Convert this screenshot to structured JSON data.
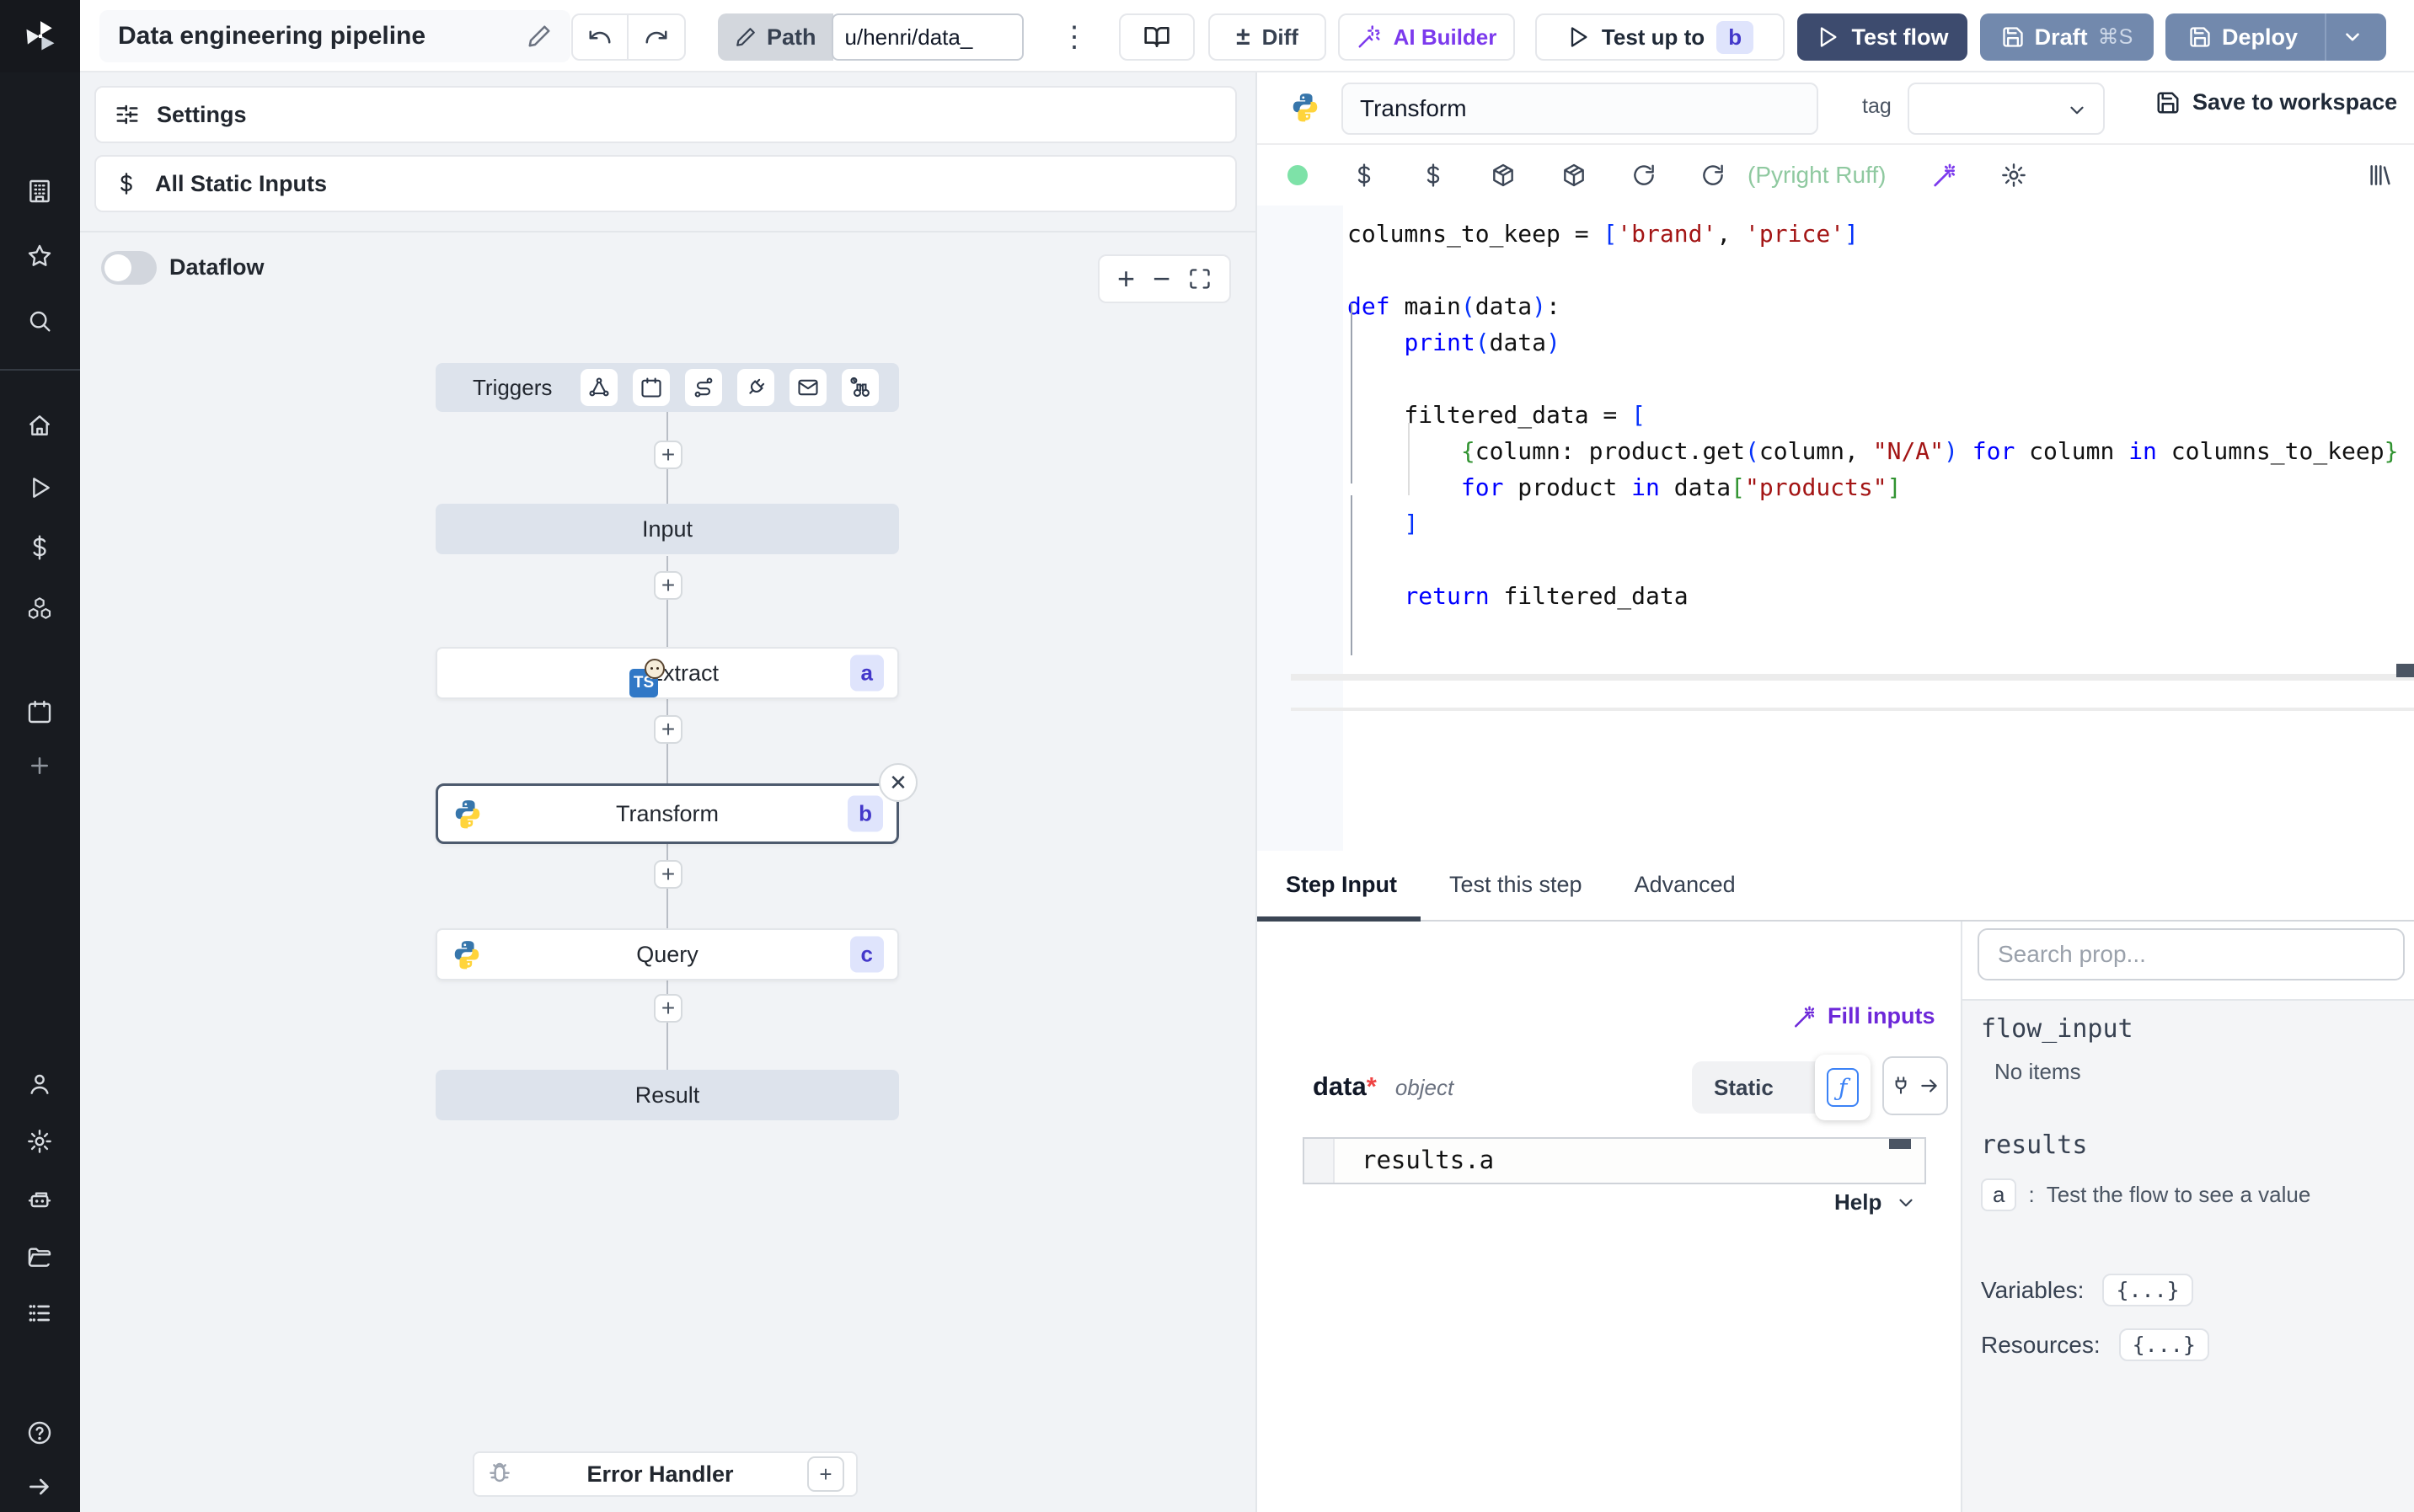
{
  "topbar": {
    "title": "Data engineering pipeline",
    "path_label": "Path",
    "path_value": "u/henri/data_",
    "kebab": "⋮",
    "diff_symbol": "±",
    "diff_label": "Diff",
    "ai_builder_label": "AI Builder",
    "test_up_to_label": "Test up to",
    "test_up_to_badge": "b",
    "test_flow_label": "Test flow",
    "draft_label": "Draft",
    "draft_shortcut": "⌘S",
    "deploy_label": "Deploy"
  },
  "left_panel": {
    "settings_label": "Settings",
    "all_static_inputs_label": "All Static Inputs",
    "dataflow_label": "Dataflow",
    "zoom_in": "+",
    "zoom_out": "−"
  },
  "flow": {
    "triggers_label": "Triggers",
    "input_label": "Input",
    "extract_label": "Extract",
    "extract_badge": "a",
    "extract_icon_text": "TS",
    "transform_label": "Transform",
    "transform_badge": "b",
    "close_symbol": "✕",
    "plus_symbol": "+",
    "query_label": "Query",
    "query_badge": "c",
    "result_label": "Result",
    "error_handler_label": "Error Handler"
  },
  "editor": {
    "step_name": "Transform",
    "tag_label": "tag",
    "save_label": "Save to workspace",
    "lint_status": "(Pyright Ruff)",
    "code_lines": [
      [
        [
          "t",
          "columns_to_keep = "
        ],
        [
          "b1",
          "["
        ],
        [
          "s",
          "'brand'"
        ],
        [
          "t",
          ", "
        ],
        [
          "s",
          "'price'"
        ],
        [
          "b1",
          "]"
        ]
      ],
      [],
      [
        [
          "k",
          "def "
        ],
        [
          "t",
          "main"
        ],
        [
          "b1",
          "("
        ],
        [
          "t",
          "data"
        ],
        [
          "b1",
          ")"
        ],
        [
          "t",
          ":"
        ]
      ],
      [
        [
          "t",
          "    "
        ],
        [
          "k",
          "print"
        ],
        [
          "b1",
          "("
        ],
        [
          "t",
          "data"
        ],
        [
          "b1",
          ")"
        ]
      ],
      [],
      [
        [
          "t",
          "    filtered_data = "
        ],
        [
          "b1",
          "["
        ]
      ],
      [
        [
          "t",
          "        "
        ],
        [
          "b2",
          "{"
        ],
        [
          "t",
          "column: product.get"
        ],
        [
          "b1",
          "("
        ],
        [
          "t",
          "column, "
        ],
        [
          "s",
          "\"N/A\""
        ],
        [
          "b1",
          ")"
        ],
        [
          "t",
          " "
        ],
        [
          "k",
          "for"
        ],
        [
          "t",
          " column "
        ],
        [
          "k",
          "in"
        ],
        [
          "t",
          " columns_to_keep"
        ],
        [
          "b2",
          "}"
        ]
      ],
      [
        [
          "t",
          "        "
        ],
        [
          "k",
          "for"
        ],
        [
          "t",
          " product "
        ],
        [
          "k",
          "in"
        ],
        [
          "t",
          " data"
        ],
        [
          "b2",
          "["
        ],
        [
          "s",
          "\"products\""
        ],
        [
          "b2",
          "]"
        ]
      ],
      [
        [
          "t",
          "    "
        ],
        [
          "b1",
          "]"
        ]
      ],
      [],
      [
        [
          "t",
          "    "
        ],
        [
          "k",
          "return"
        ],
        [
          "t",
          " filtered_data"
        ]
      ]
    ]
  },
  "tabs": {
    "step_input": "Step Input",
    "test_this_step": "Test this step",
    "advanced": "Advanced"
  },
  "step_input": {
    "fill_inputs_label": "Fill inputs",
    "field_name": "data",
    "field_required": "*",
    "field_type": "object",
    "static_label": "Static",
    "fn_symbol": "ƒ",
    "expr_value": "results.a",
    "help_label": "Help"
  },
  "props": {
    "search_placeholder": "Search prop...",
    "flow_input_label": "flow_input",
    "no_items": "No items",
    "results_label": "results",
    "result_key": "a",
    "result_separator": ":",
    "result_hint": "Test the flow to see a value",
    "variables_label": "Variables:",
    "resources_label": "Resources:",
    "object_preview": "{...}"
  },
  "colors": {
    "accent_purple": "#7c3aed",
    "dark_button": "#3d4b6e",
    "slate_button": "#7289ad",
    "badge_bg": "#dfe4fc",
    "badge_text": "#4338ca",
    "lint_green": "#8fc9a0",
    "status_green": "#7ee2a8",
    "sidebar_bg": "#181b20",
    "canvas_bg": "#f1f3f6",
    "node_gray": "#dde3ec"
  }
}
